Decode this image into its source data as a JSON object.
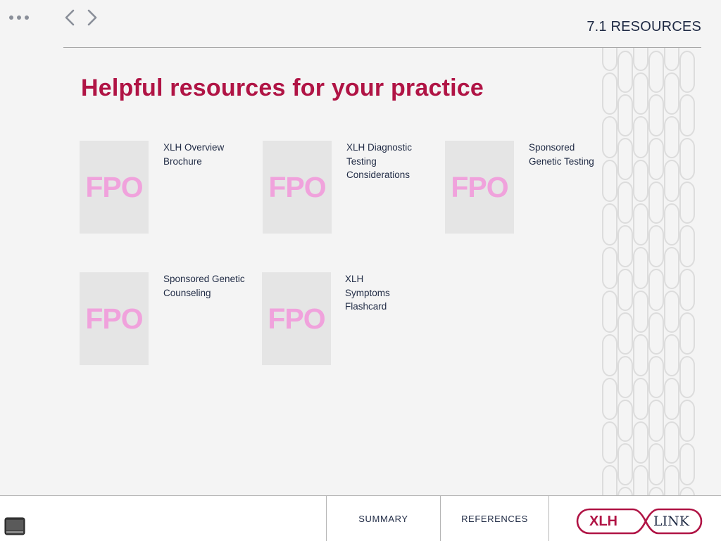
{
  "header": {
    "section_title": "7.1 RESOURCES"
  },
  "main": {
    "title": "Helpful resources for your practice",
    "resources": [
      {
        "thumb_text": "FPO",
        "label": "XLH Overview\nBrochure"
      },
      {
        "thumb_text": "FPO",
        "label": "XLH Diagnostic\nTesting\nConsiderations"
      },
      {
        "thumb_text": "FPO",
        "label": "Sponsored\nGenetic Testing"
      },
      {
        "thumb_text": "FPO",
        "label": "Sponsored Genetic\nCounseling"
      },
      {
        "thumb_text": "FPO",
        "label": "XLH\nSymptoms\nFlashcard"
      }
    ]
  },
  "footer": {
    "summary_label": "SUMMARY",
    "references_label": "REFERENCES",
    "logo_left": "XLH",
    "logo_right": "LINK"
  },
  "colors": {
    "brand": "#b01445",
    "navy": "#1f2a44",
    "placeholder_text": "#f0a2dc",
    "background": "#f4f4f4"
  }
}
